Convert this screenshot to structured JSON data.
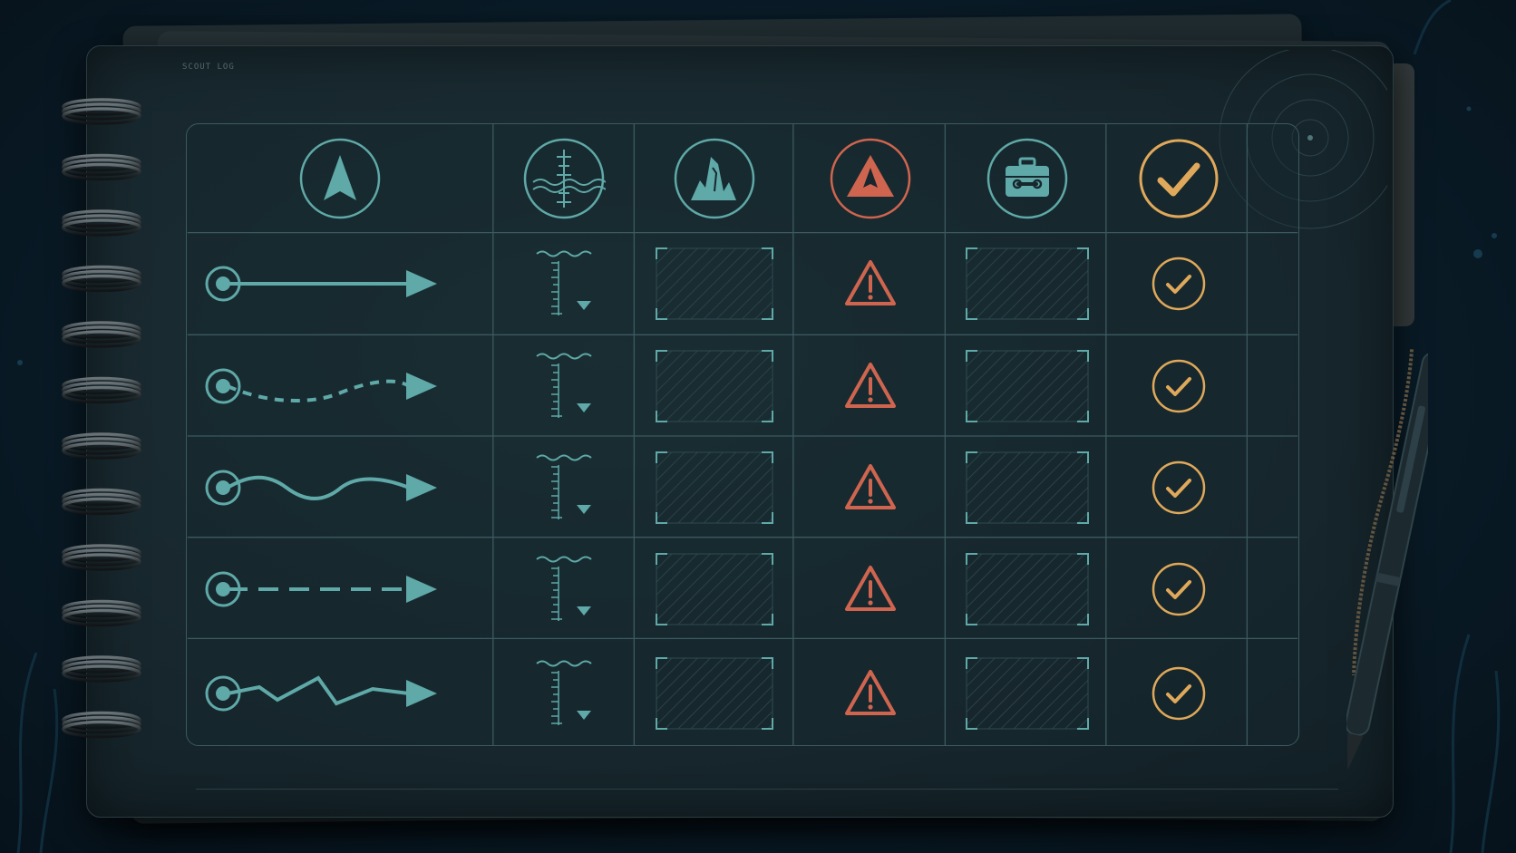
{
  "notebook": {
    "corner_label": "SCOUT LOG"
  },
  "colors": {
    "background": "#0a1c28",
    "page": "#17272d",
    "grid_line": "#3b5a60",
    "teal_accent": "#5fa9a8",
    "hazard_red": "#d0654f",
    "check_amber": "#e0a85a"
  },
  "columns": [
    {
      "icon": "navigation-arrow-icon",
      "meaning": "route"
    },
    {
      "icon": "depth-gauge-icon",
      "meaning": "depth"
    },
    {
      "icon": "rock-formation-icon",
      "meaning": "terrain"
    },
    {
      "icon": "hazard-warning-icon",
      "meaning": "hazard"
    },
    {
      "icon": "toolbox-icon",
      "meaning": "equipment"
    },
    {
      "icon": "checkmark-icon",
      "meaning": "status"
    }
  ],
  "rows": [
    {
      "route_style": "straight",
      "terrain_slot": "empty",
      "equipment_slot": "empty",
      "hazard": "warning-triangle-icon",
      "status": "checked"
    },
    {
      "route_style": "dotted-curve",
      "terrain_slot": "empty",
      "equipment_slot": "empty",
      "hazard": "warning-triangle-icon",
      "status": "checked"
    },
    {
      "route_style": "wavy",
      "terrain_slot": "empty",
      "equipment_slot": "empty",
      "hazard": "warning-triangle-icon",
      "status": "checked"
    },
    {
      "route_style": "dashed",
      "terrain_slot": "empty",
      "equipment_slot": "empty",
      "hazard": "warning-triangle-icon",
      "status": "checked"
    },
    {
      "route_style": "zigzag",
      "terrain_slot": "empty",
      "equipment_slot": "empty",
      "hazard": "warning-triangle-icon",
      "status": "checked"
    }
  ]
}
